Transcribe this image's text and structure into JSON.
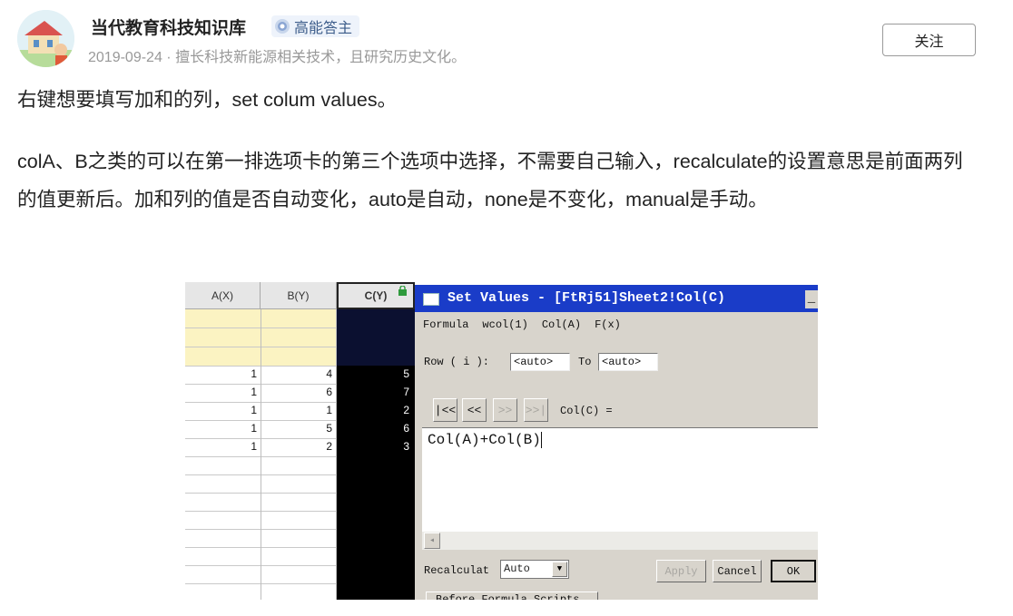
{
  "header": {
    "author": "当代教育科技知识库",
    "badge": "高能答主",
    "meta": "2019-09-24 · 擅长科技新能源相关技术，且研究历史文化。",
    "follow_label": "关注"
  },
  "body": {
    "paragraph1": "右键想要填写加和的列，set colum values。",
    "paragraph2": "colA、B之类的可以在第一排选项卡的第三个选项中选择，不需要自己输入，recalculate的设置意思是前面两列的值更新后。加和列的值是否自动变化，auto是自动，none是不变化，manual是手动。"
  },
  "screenshot": {
    "columns": [
      "A(X)",
      "B(Y)",
      "C(Y)"
    ],
    "rows": [
      {
        "a": "1",
        "b": "4",
        "c": "5"
      },
      {
        "a": "1",
        "b": "6",
        "c": "7"
      },
      {
        "a": "1",
        "b": "1",
        "c": "2"
      },
      {
        "a": "1",
        "b": "5",
        "c": "6"
      },
      {
        "a": "1",
        "b": "2",
        "c": "3"
      }
    ],
    "dialog": {
      "title": "Set Values - [FtRj51]Sheet2!Col(C)",
      "minimize": "_",
      "menu": [
        "Formula",
        "wcol(1)",
        "Col(A)",
        "F(x)"
      ],
      "row_label": "Row ( i ):",
      "row_from": "<auto>",
      "to_label": "To",
      "row_to": "<auto>",
      "nav_buttons": [
        "|<<",
        "<<",
        ">>",
        ">>|"
      ],
      "col_label": "Col(C) =",
      "formula": "Col(A)+Col(B)",
      "scroll_left": "◂",
      "recalculate_label": "Recalculat",
      "recalculate_value": "Auto",
      "dropdown_arrow": "▼",
      "apply_label": "Apply",
      "cancel_label": "Cancel",
      "ok_label": "OK",
      "bottom_button": "Before Formula Scripts"
    }
  },
  "colors": {
    "dialog_title_bg": "#1a3cc8",
    "highlight_rows": "#fbf3c2",
    "col_c_bg": "#000000"
  }
}
